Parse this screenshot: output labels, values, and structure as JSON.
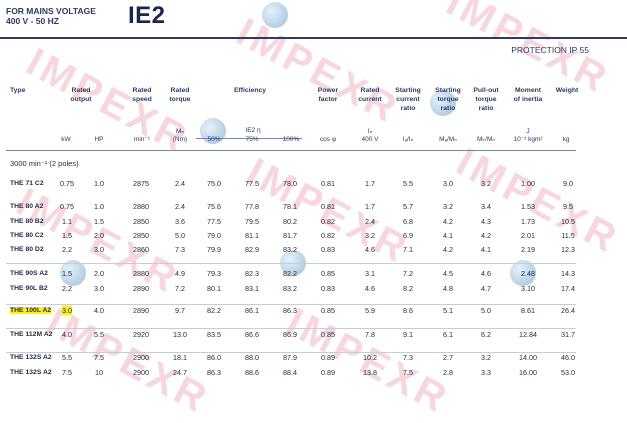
{
  "header": {
    "voltage_line1": "FOR MAINS VOLTAGE",
    "voltage_line2": "400 V - 50 HZ",
    "efficiency_class": "IE2",
    "protection": "PROTECTION IP 55"
  },
  "columns": {
    "type": "Type",
    "rated_output": "Rated\noutput",
    "rated_speed": "Rated\nspeed",
    "rated_torque": "Rated\ntorque",
    "efficiency": "Efficiency",
    "power_factor": "Power\nfactor",
    "rated_current": "Rated\ncurrent",
    "starting_current": "Starting\ncurrent\nratio",
    "starting_torque": "Starting\ntorque\nratio",
    "pullout_torque": "Pull-out\ntorque\nratio",
    "moment_inertia": "Moment\nof inertia",
    "weight": "Weight"
  },
  "units": {
    "kw": "kW",
    "hp": "HP",
    "speed": "min⁻¹",
    "torque": "Mₙ\n(Nm)",
    "eff_50": "50%",
    "eff_ie2": "IE2 η",
    "eff_75": "75%",
    "eff_100": "100%",
    "pf": "cos φ",
    "current": "Iₙ\n400 V",
    "start_current": "Iₐ/Iₙ",
    "start_torque": "Mₐ/Mₙ",
    "pullout": "Mₖ/Mₙ",
    "inertia": "J\n10⁻³ kgm²",
    "weight": "kg"
  },
  "section_label": "3000 min⁻¹ (2 poles)",
  "rows": [
    {
      "type": "THE 71 C2",
      "kw": "0.75",
      "hp": "1.0",
      "speed": "2875",
      "torque": "2.4",
      "e50": "75.0",
      "e75": "77.5",
      "e100": "78.0",
      "pf": "0.81",
      "cur": "1.7",
      "ia": "5.5",
      "ma": "3.0",
      "mk": "3.2",
      "j": "1.00",
      "kg": "9.0"
    },
    {
      "type": "THE 80 A2",
      "kw": "0.75",
      "hp": "1.0",
      "speed": "2880",
      "torque": "2.4",
      "e50": "75.6",
      "e75": "77.8",
      "e100": "78.1",
      "pf": "0.81",
      "cur": "1.7",
      "ia": "5.7",
      "ma": "3.2",
      "mk": "3.4",
      "j": "1.53",
      "kg": "9.5"
    },
    {
      "type": "THE 80 B2",
      "kw": "1.1",
      "hp": "1.5",
      "speed": "2850",
      "torque": "3.6",
      "e50": "77.5",
      "e75": "79.5",
      "e100": "80.2",
      "pf": "0.82",
      "cur": "2.4",
      "ia": "6.8",
      "ma": "4.2",
      "mk": "4.3",
      "j": "1.73",
      "kg": "10.5"
    },
    {
      "type": "THE 80 C2",
      "kw": "1.5",
      "hp": "2.0",
      "speed": "2850",
      "torque": "5.0",
      "e50": "79.0",
      "e75": "81.1",
      "e100": "81.7",
      "pf": "0.82",
      "cur": "3.2",
      "ia": "6.9",
      "ma": "4.1",
      "mk": "4.2",
      "j": "2.01",
      "kg": "11.5"
    },
    {
      "type": "THE 80 D2",
      "kw": "2.2",
      "hp": "3.0",
      "speed": "2860",
      "torque": "7.3",
      "e50": "79.9",
      "e75": "82.9",
      "e100": "83.2",
      "pf": "0.83",
      "cur": "4.6",
      "ia": "7.1",
      "ma": "4.2",
      "mk": "4.1",
      "j": "2.19",
      "kg": "12.3"
    },
    {
      "type": "THE 90S A2",
      "kw": "1.5",
      "hp": "2.0",
      "speed": "2880",
      "torque": "4.9",
      "e50": "79.3",
      "e75": "82.3",
      "e100": "82.2",
      "pf": "0.85",
      "cur": "3.1",
      "ia": "7.2",
      "ma": "4.5",
      "mk": "4.6",
      "j": "2.48",
      "kg": "14.3"
    },
    {
      "type": "THE 90L B2",
      "kw": "2.2",
      "hp": "3.0",
      "speed": "2890",
      "torque": "7.2",
      "e50": "80.1",
      "e75": "83.1",
      "e100": "83.2",
      "pf": "0.83",
      "cur": "4.6",
      "ia": "8.2",
      "ma": "4.8",
      "mk": "4.7",
      "j": "3.10",
      "kg": "17.4"
    },
    {
      "type": "THE 100L A2",
      "kw": "3.0",
      "hp": "4.0",
      "speed": "2890",
      "torque": "9.7",
      "e50": "82.2",
      "e75": "86.1",
      "e100": "86.3",
      "pf": "0.85",
      "cur": "5.9",
      "ia": "8.6",
      "ma": "5.1",
      "mk": "5.0",
      "j": "8.61",
      "kg": "26.4",
      "highlight": true
    },
    {
      "type": "THE 112M A2",
      "kw": "4.0",
      "hp": "5.5",
      "speed": "2920",
      "torque": "13.0",
      "e50": "83.5",
      "e75": "86.6",
      "e100": "86.9",
      "pf": "0.85",
      "cur": "7.8",
      "ia": "9.1",
      "ma": "6.1",
      "mk": "6.2",
      "j": "12.84",
      "kg": "31.7"
    },
    {
      "type": "THE 132S A2",
      "kw": "5.5",
      "hp": "7.5",
      "speed": "2900",
      "torque": "18.1",
      "e50": "86.0",
      "e75": "88.0",
      "e100": "87.9",
      "pf": "0.89",
      "cur": "10.2",
      "ia": "7.3",
      "ma": "2.7",
      "mk": "3.2",
      "j": "14.00",
      "kg": "46.0"
    },
    {
      "type": "THE 132S A2",
      "kw": "7.5",
      "hp": "10",
      "speed": "2900",
      "torque": "24.7",
      "e50": "86.3",
      "e75": "88.6",
      "e100": "88.4",
      "pf": "0.89",
      "cur": "13.8",
      "ia": "7.5",
      "ma": "2.8",
      "mk": "3.3",
      "j": "16.00",
      "kg": "53.0"
    }
  ],
  "watermark": "IMPEXR"
}
